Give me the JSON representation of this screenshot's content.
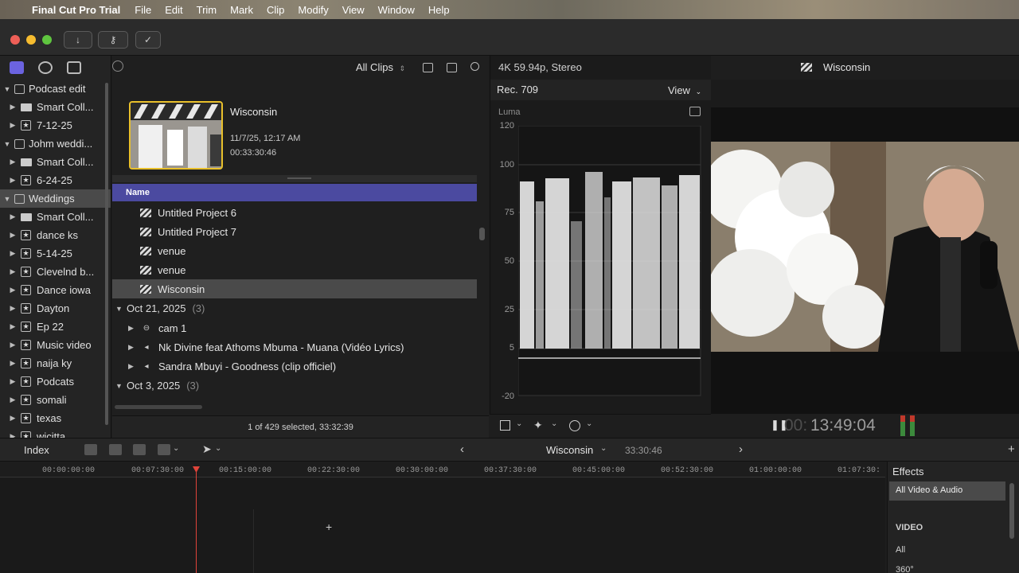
{
  "menubar": {
    "app_name": "Final Cut Pro Trial",
    "items": [
      "File",
      "Edit",
      "Trim",
      "Mark",
      "Clip",
      "Modify",
      "View",
      "Window",
      "Help"
    ]
  },
  "toolbar": {
    "import_icon": "download-arrow-icon",
    "keywords_icon": "key-icon",
    "background_tasks_icon": "checkmark-circle-icon"
  },
  "sidebar": {
    "items": [
      {
        "label": "Podcast edit",
        "type": "library",
        "level": 0
      },
      {
        "label": "Smart Coll...",
        "type": "folder",
        "level": 1
      },
      {
        "label": "7-12-25",
        "type": "event",
        "level": 1
      },
      {
        "label": "Johm weddi...",
        "type": "library",
        "level": 0
      },
      {
        "label": "Smart Coll...",
        "type": "folder",
        "level": 1
      },
      {
        "label": "6-24-25",
        "type": "event",
        "level": 1
      },
      {
        "label": "Weddings",
        "type": "library",
        "level": 0,
        "selected": true
      },
      {
        "label": "Smart Coll...",
        "type": "folder",
        "level": 1
      },
      {
        "label": "dance ks",
        "type": "event",
        "level": 1
      },
      {
        "label": "5-14-25",
        "type": "event",
        "level": 1
      },
      {
        "label": "Clevelnd b...",
        "type": "event",
        "level": 1
      },
      {
        "label": "Dance  iowa",
        "type": "event",
        "level": 1
      },
      {
        "label": "Dayton",
        "type": "event",
        "level": 1
      },
      {
        "label": "Ep 22",
        "type": "event",
        "level": 1
      },
      {
        "label": "Music video",
        "type": "event",
        "level": 1
      },
      {
        "label": "naija ky",
        "type": "event",
        "level": 1
      },
      {
        "label": "Podcats",
        "type": "event",
        "level": 1
      },
      {
        "label": "somali",
        "type": "event",
        "level": 1
      },
      {
        "label": "texas",
        "type": "event",
        "level": 1
      },
      {
        "label": "wicitta",
        "type": "event",
        "level": 1
      }
    ]
  },
  "browser": {
    "filter": "All Clips",
    "clip": {
      "title": "Wisconsin",
      "date": "11/7/25, 12:17 AM",
      "duration": "00:33:30:46"
    },
    "column_header": "Name",
    "rows": [
      {
        "label": "Untitled Project 6",
        "kind": "project"
      },
      {
        "label": "Untitled Project 7",
        "kind": "project"
      },
      {
        "label": "venue",
        "kind": "project"
      },
      {
        "label": "venue",
        "kind": "project"
      },
      {
        "label": "Wisconsin",
        "kind": "project",
        "selected": true
      }
    ],
    "groups": [
      {
        "label": "Oct 21, 2025",
        "count": "(3)",
        "rows": [
          {
            "label": "cam 1",
            "kind": "multicam"
          },
          {
            "label": "Nk Divine feat Athoms Mbuma - Muana (Vidéo Lyrics)",
            "kind": "audio"
          },
          {
            "label": "Sandra Mbuyi - Goodness (clip officiel)",
            "kind": "audio"
          }
        ]
      },
      {
        "label": "Oct 3, 2025",
        "count": "(3)",
        "rows": []
      }
    ],
    "status": "1 of 429 selected, 33:32:39"
  },
  "scopes": {
    "format": "4K 59.94p, Stereo",
    "colorspace": "Rec. 709",
    "view_label": "View",
    "scope_name": "Luma",
    "scale": [
      "120",
      "100",
      "75",
      "50",
      "25",
      "5",
      "-20"
    ]
  },
  "viewer": {
    "title": "Wisconsin",
    "timecode_dim": "00:",
    "timecode": "13:49:04"
  },
  "timeline_bar": {
    "index_label": "Index",
    "project_name": "Wisconsin",
    "duration": "33:30:46"
  },
  "ruler": [
    "00:00:00:00",
    "00:07:30:00",
    "00:15:00:00",
    "00:22:30:00",
    "00:30:00:00",
    "00:37:30:00",
    "00:45:00:00",
    "00:52:30:00",
    "01:00:00:00",
    "01:07:30:"
  ],
  "effects": {
    "title": "Effects",
    "selected": "All Video & Audio",
    "section": "VIDEO",
    "items": [
      "All",
      "360°"
    ]
  },
  "colors": {
    "list_header": "#4b4aa0",
    "selection": "#4a4a4a",
    "thumb_border": "#e9c02b",
    "playhead": "#e0443a",
    "effects_selected": "#4a4a4a"
  }
}
